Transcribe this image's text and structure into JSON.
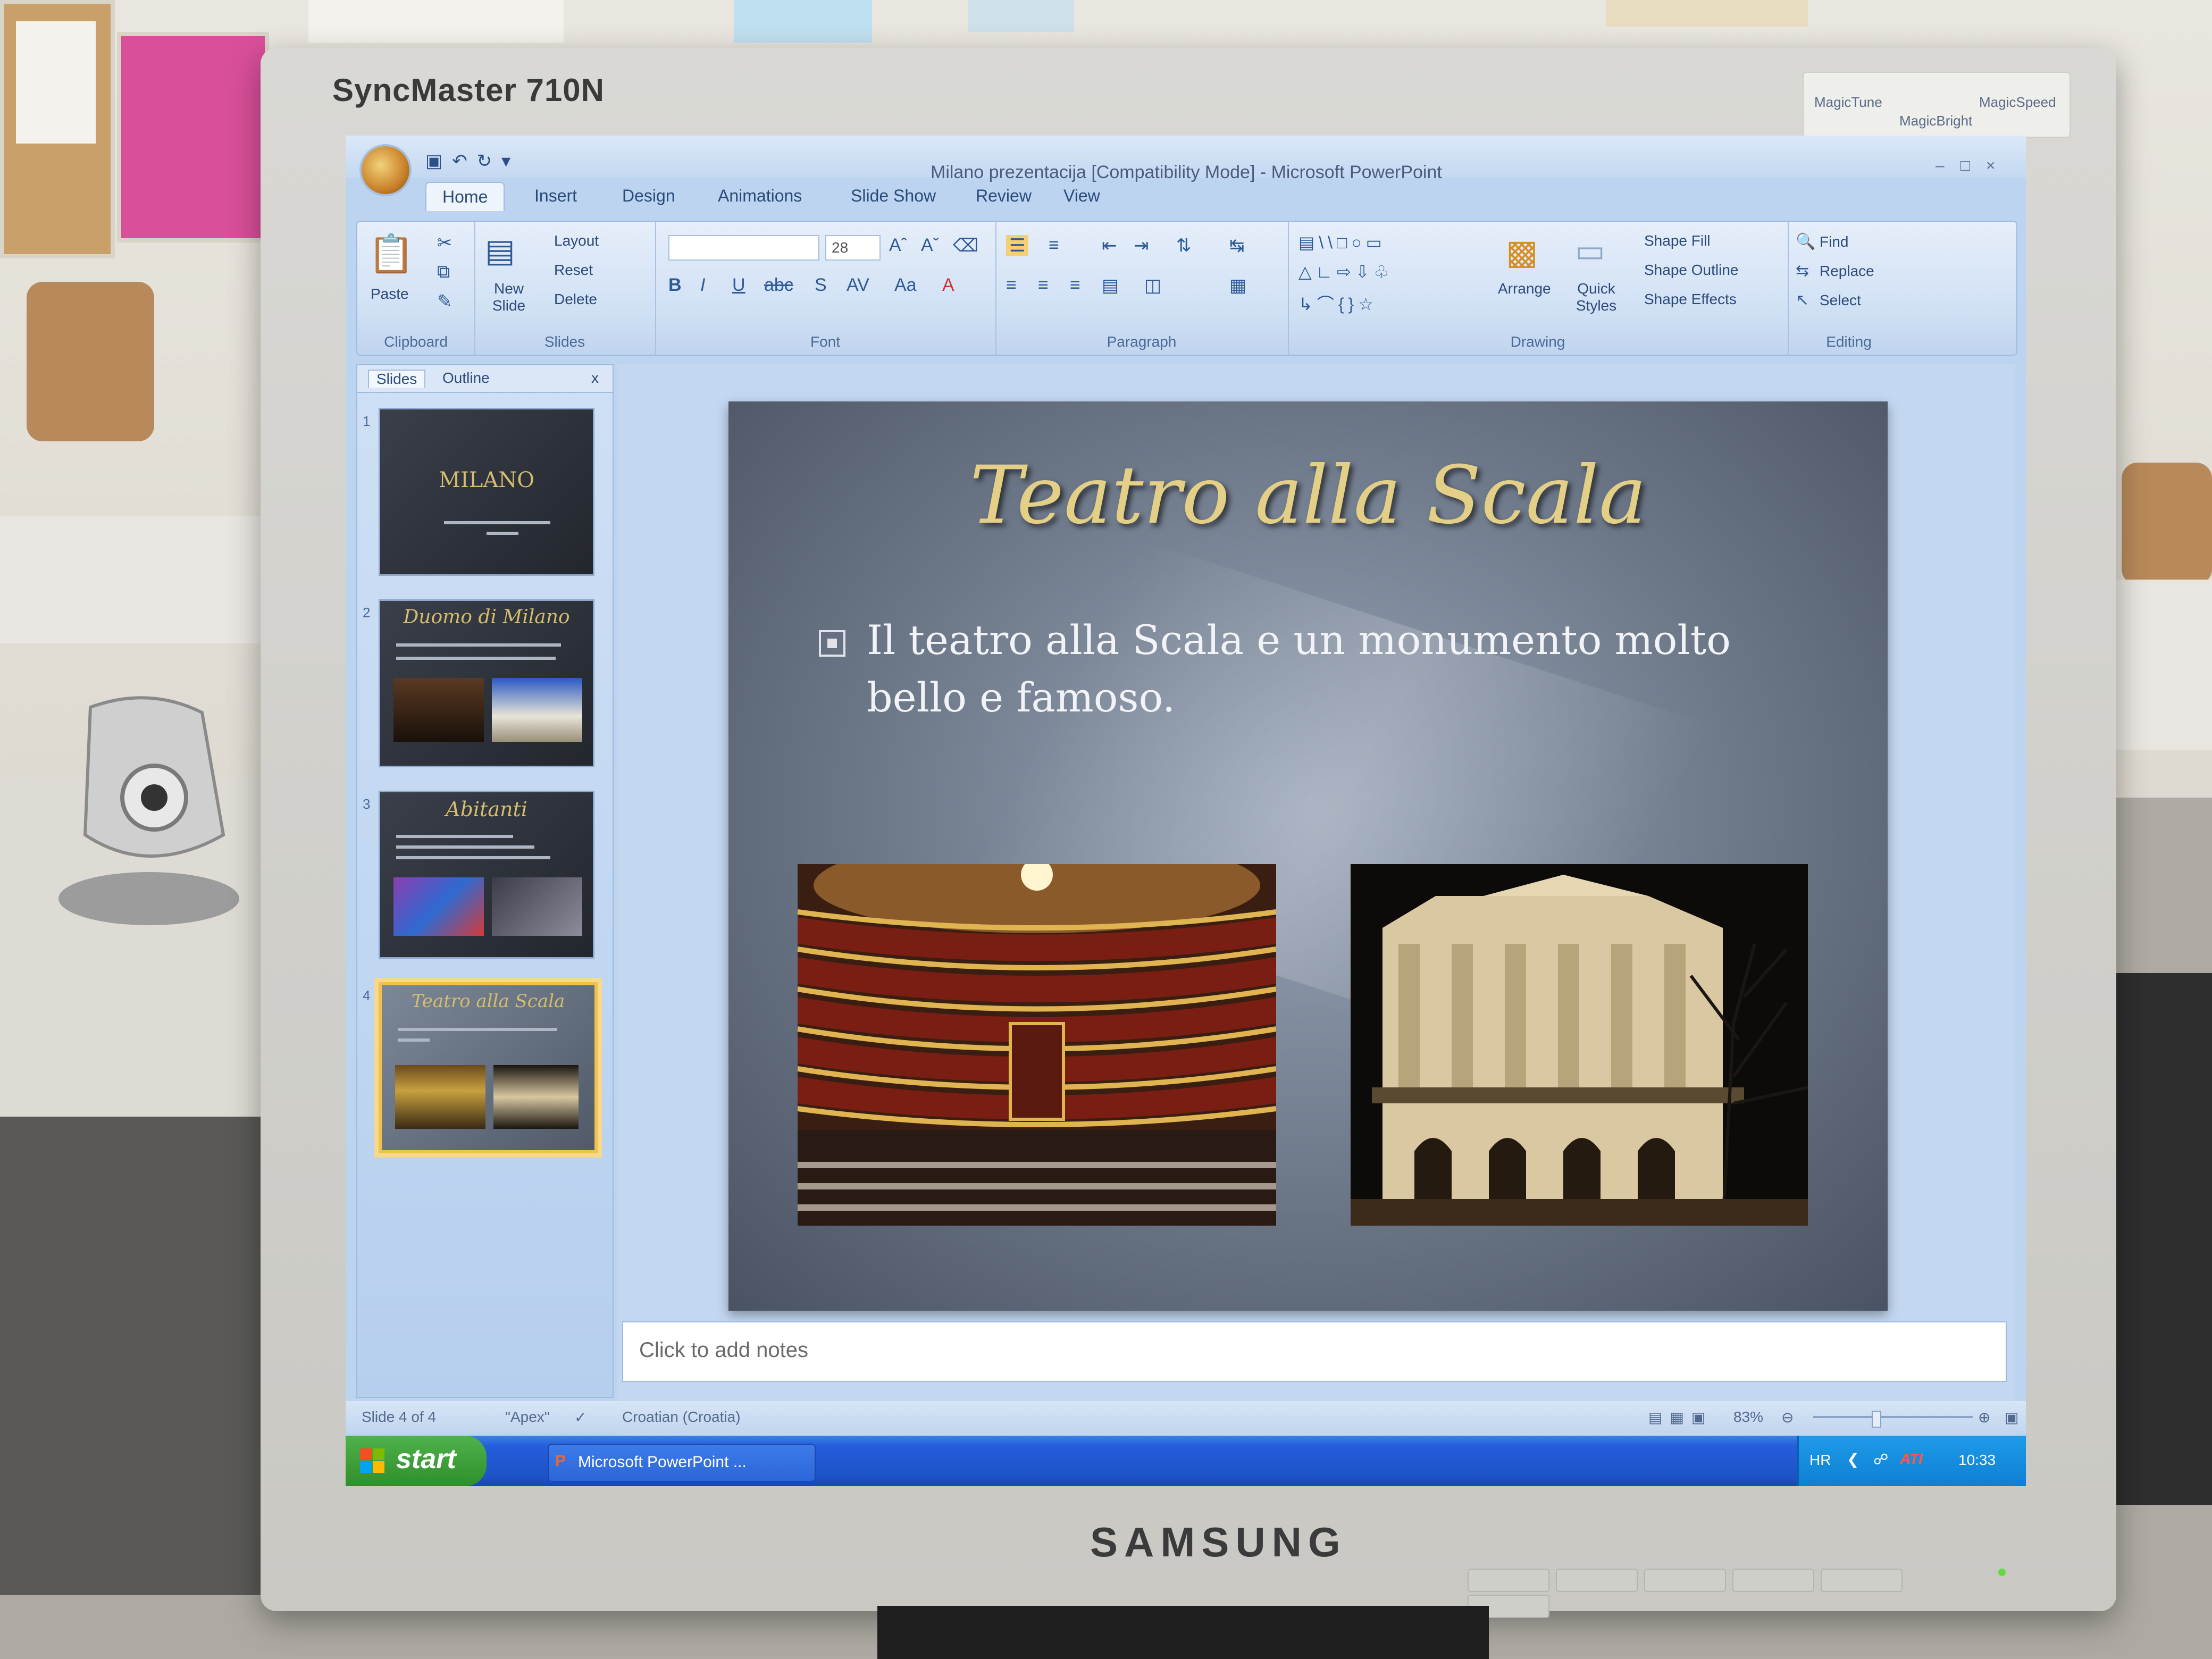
{
  "bezel": {
    "model": "SyncMaster 710N",
    "features": [
      "MagicTune",
      "MagicBright",
      "MagicSpeed"
    ],
    "brand": "SAMSUNG"
  },
  "window": {
    "title": "Milano prezentacija [Compatibility Mode] - Microsoft PowerPoint"
  },
  "ribbon": {
    "tabs": [
      "Home",
      "Insert",
      "Design",
      "Animations",
      "Slide Show",
      "Review",
      "View"
    ],
    "active_tab": "Home",
    "clipboard": {
      "paste": "Paste",
      "label": "Clipboard"
    },
    "slides": {
      "new_slide": "New Slide",
      "layout": "Layout",
      "reset": "Reset",
      "delete": "Delete",
      "label": "Slides"
    },
    "font": {
      "size": "28",
      "label": "Font"
    },
    "paragraph": {
      "label": "Paragraph"
    },
    "drawing": {
      "arrange": "Arrange",
      "quick_styles": "Quick Styles",
      "shape_fill": "Shape Fill",
      "shape_outline": "Shape Outline",
      "shape_effects": "Shape Effects",
      "label": "Drawing"
    },
    "editing": {
      "find": "Find",
      "replace": "Replace",
      "select": "Select",
      "label": "Editing"
    }
  },
  "pane": {
    "tabs": [
      "Slides",
      "Outline"
    ],
    "close": "x",
    "thumbnails": [
      {
        "number": "1",
        "title": "MILANO"
      },
      {
        "number": "2",
        "title": "Duomo di Milano"
      },
      {
        "number": "3",
        "title": "Abitanti"
      },
      {
        "number": "4",
        "title": "Teatro alla Scala"
      }
    ]
  },
  "slide": {
    "title": "Teatro alla Scala",
    "bullet": "Il teatro alla Scala e un monumento molto bello e famoso."
  },
  "notes": {
    "placeholder": "Click to add notes"
  },
  "statusbar": {
    "slide_info": "Slide 4 of 4",
    "theme": "\"Apex\"",
    "language": "Croatian (Croatia)",
    "zoom": "83%"
  },
  "taskbar": {
    "start": "start",
    "task": "Microsoft PowerPoint ...",
    "lang": "HR",
    "clock": "10:33"
  },
  "colors": {
    "title_gold": "#e3cf86",
    "slide_bg": "#6b7687",
    "ribbon_bg": "#cfe0f4",
    "taskbar_blue": "#245edb",
    "start_green": "#3a9a36"
  }
}
